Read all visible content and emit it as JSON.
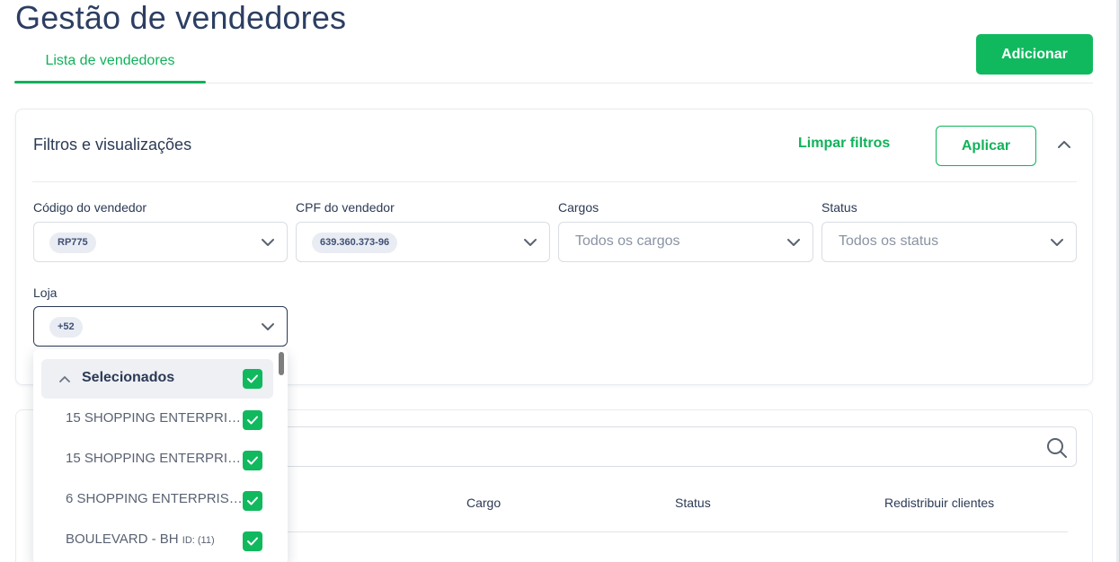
{
  "header": {
    "title": "Gestão de vendedores",
    "add_label": "Adicionar"
  },
  "tabs": [
    {
      "label": "Lista de vendedores",
      "active": true
    }
  ],
  "filters": {
    "title": "Filtros e visualizações",
    "clear_label": "Limpar filtros",
    "apply_label": "Aplicar",
    "fields": {
      "seller_code": {
        "label": "Código do vendedor",
        "chip": "RP775"
      },
      "seller_cpf": {
        "label": "CPF do vendedor",
        "chip": "639.360.373-96"
      },
      "roles": {
        "label": "Cargos",
        "placeholder": "Todos os cargos"
      },
      "status": {
        "label": "Status",
        "placeholder": "Todos os status"
      },
      "store": {
        "label": "Loja",
        "chip": "+52"
      }
    }
  },
  "store_dropdown": {
    "group_label": "Selecionados",
    "items": [
      {
        "label": "15 SHOPPING ENTERPRISE...",
        "checked": true
      },
      {
        "label": "15 SHOPPING ENTERPRISE...",
        "checked": true
      },
      {
        "label": "6 SHOPPING ENTERPRISE ...",
        "checked": true
      },
      {
        "label": "BOULEVARD - BH",
        "id_tag": "ID: (11)",
        "checked": true
      }
    ]
  },
  "table": {
    "search_placeholder": "",
    "columns": [
      "Cargo",
      "Status",
      "Redistribuir clientes"
    ]
  },
  "colors": {
    "accent": "#10b95e",
    "text": "#2b3a55",
    "muted": "#8a93a3",
    "chip_bg": "#e9ecf2"
  }
}
